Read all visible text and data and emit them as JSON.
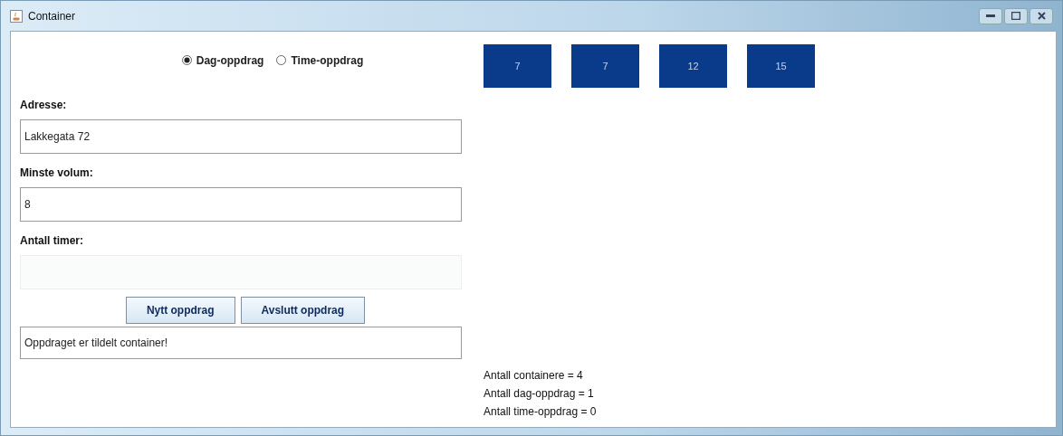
{
  "window": {
    "title": "Container"
  },
  "order_type": [
    {
      "label": "Dag-oppdrag",
      "selected": true
    },
    {
      "label": "Time-oppdrag",
      "selected": false
    }
  ],
  "fields": [
    {
      "label": "Adresse:",
      "value": "Lakkegata 72",
      "disabled": false
    },
    {
      "label": "Minste volum:",
      "value": "8",
      "disabled": false
    },
    {
      "label": "Antall timer:",
      "disabled": true
    }
  ],
  "buttons": [
    "Nytt oppdrag",
    "Avslutt oppdrag"
  ],
  "message": "Oppdraget er tildelt container!",
  "containers": [
    "7",
    "7",
    "12",
    "15"
  ],
  "stats": [
    "Antall containere = 4",
    "Antall dag-oppdrag = 1",
    "Antall time-oppdrag = 0"
  ]
}
